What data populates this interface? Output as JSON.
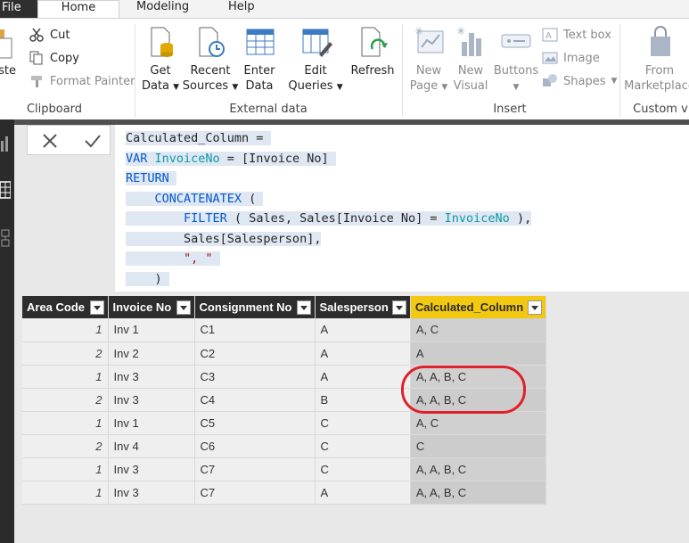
{
  "menu": {
    "file": "File",
    "tabs": [
      "Home",
      "Modeling",
      "Help"
    ]
  },
  "ribbon": {
    "clipboard": {
      "paste_partial": "aste",
      "cut": "Cut",
      "copy": "Copy",
      "format_painter": "Format Painter",
      "label": "Clipboard"
    },
    "external_data": {
      "get_data": [
        "Get",
        "Data"
      ],
      "recent_sources": [
        "Recent",
        "Sources"
      ],
      "enter_data": [
        "Enter",
        "Data"
      ],
      "edit_queries": [
        "Edit",
        "Queries"
      ],
      "refresh": "Refresh",
      "label": "External data"
    },
    "insert": {
      "new_page": [
        "New",
        "Page"
      ],
      "new_visual": [
        "New",
        "Visual"
      ],
      "buttons": "Buttons",
      "text_box": "Text box",
      "image": "Image",
      "shapes": "Shapes",
      "label": "Insert"
    },
    "custom": {
      "from_marketplace": [
        "From",
        "Marketplace"
      ],
      "label": "Custom v"
    }
  },
  "formula": {
    "lines": [
      [
        {
          "t": "Calculated_Column = ",
          "c": ""
        }
      ],
      [
        {
          "t": "VAR ",
          "c": "kw"
        },
        {
          "t": "InvoiceNo",
          "c": "var"
        },
        {
          "t": " = [Invoice No] ",
          "c": ""
        }
      ],
      [
        {
          "t": "RETURN ",
          "c": "kw"
        }
      ],
      [
        {
          "t": "    CONCATENATEX",
          "c": "kw"
        },
        {
          "t": " ( ",
          "c": ""
        }
      ],
      [
        {
          "t": "        ",
          "c": ""
        },
        {
          "t": "FILTER",
          "c": "kw"
        },
        {
          "t": " ( Sales, Sales[Invoice No] = ",
          "c": ""
        },
        {
          "t": "InvoiceNo",
          "c": "var"
        },
        {
          "t": " ),",
          "c": ""
        }
      ],
      [
        {
          "t": "        Sales[Salesperson],",
          "c": ""
        }
      ],
      [
        {
          "t": "        ",
          "c": ""
        },
        {
          "t": "\", \"",
          "c": "str"
        },
        {
          "t": " ",
          "c": ""
        }
      ],
      [
        {
          "t": "    ) ",
          "c": ""
        }
      ]
    ]
  },
  "table": {
    "columns": [
      "Area Code",
      "Invoice No",
      "Consignment No",
      "Salesperson",
      "Calculated_Column"
    ],
    "rows": [
      [
        "1",
        "Inv 1",
        "C1",
        "A",
        "A, C"
      ],
      [
        "2",
        "Inv 2",
        "C2",
        "A",
        "A"
      ],
      [
        "1",
        "Inv 3",
        "C3",
        "A",
        "A, A, B, C"
      ],
      [
        "2",
        "Inv 3",
        "C4",
        "B",
        "A, A, B, C"
      ],
      [
        "1",
        "Inv 1",
        "C5",
        "C",
        "A, C"
      ],
      [
        "2",
        "Inv 4",
        "C6",
        "C",
        "C"
      ],
      [
        "1",
        "Inv 3",
        "C7",
        "C",
        "A, A, B, C"
      ],
      [
        "1",
        "Inv 3",
        "C7",
        "A",
        "A, A, B, C"
      ]
    ]
  },
  "colors": {
    "accent": "#f2c811",
    "highlight_ring": "#e0202a",
    "header_bg": "#2d2d2d"
  }
}
